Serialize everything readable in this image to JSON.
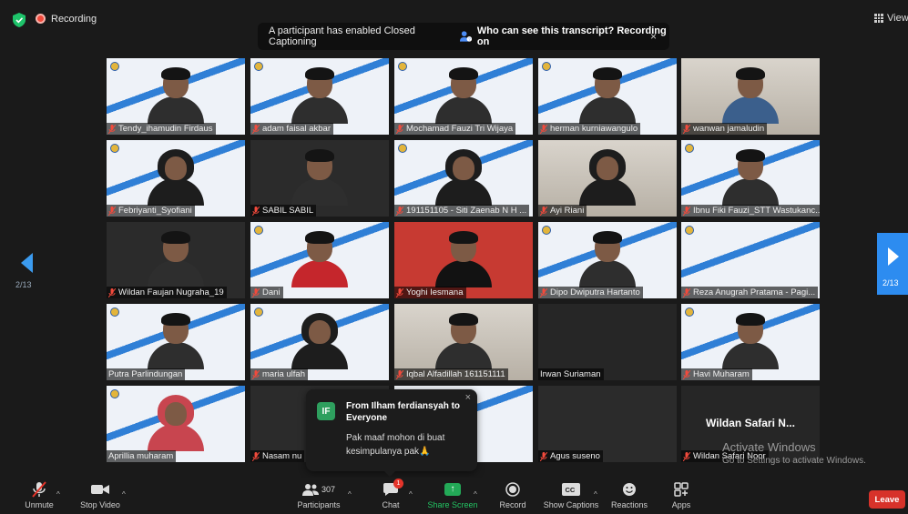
{
  "topbar": {
    "recording_label": "Recording",
    "view_label": "View",
    "caption_banner": {
      "notice": "A participant has enabled Closed Captioning",
      "question": "Who can see this transcript? Recording on",
      "close": "×"
    }
  },
  "gallery": {
    "page_left": "2/13",
    "page_right": "2/13",
    "tiles": [
      {
        "name": "Tendy_ihamudin Firdaus"
      },
      {
        "name": "adam faisal akbar"
      },
      {
        "name": "Mochamad Fauzi Tri Wijaya"
      },
      {
        "name": "herman kurniawangulo"
      },
      {
        "name": "wanwan jamaludin"
      },
      {
        "name": "Febriyanti_Syofiani"
      },
      {
        "name": "SABIL SABIL"
      },
      {
        "name": "191151105 - Siti Zaenab N H ..."
      },
      {
        "name": "Ayi Riani"
      },
      {
        "name": "Ibnu Fiki Fauzi_STT Wastukanc..."
      },
      {
        "name": "Wildan Faujan Nugraha_19"
      },
      {
        "name": "Dani"
      },
      {
        "name": "Yoghi Iesmana"
      },
      {
        "name": "Dipo Dwiputra Hartanto"
      },
      {
        "name": "Reza Anugrah Pratama - Pagi..."
      },
      {
        "name": "Putra Parlindungan"
      },
      {
        "name": "maria ulfah"
      },
      {
        "name": "Iqbal Alfadillah 161151111"
      },
      {
        "name": "Irwan Suriaman"
      },
      {
        "name": "Havi Muharam"
      },
      {
        "name": "Aprillia muharam"
      },
      {
        "name": "Nasam nu"
      },
      {
        "name": ""
      },
      {
        "name": "Agus suseno"
      },
      {
        "name": "Wildan Safari Noor",
        "center_label": "Wildan Safari N..."
      }
    ]
  },
  "chat_popup": {
    "avatar_initials": "IF",
    "from": "From Ilham ferdiansyah to Everyone",
    "message": "Pak maaf mohon di buat kesimpulanya pak🙏",
    "close": "×"
  },
  "watermark": {
    "title": "Activate Windows",
    "subtitle": "Go to Settings to activate Windows."
  },
  "toolbar": {
    "unmute": "Unmute",
    "stop_video": "Stop Video",
    "participants": "Participants",
    "participants_count": "307",
    "chat": "Chat",
    "chat_badge": "1",
    "share_screen": "Share Screen",
    "record": "Record",
    "show_captions": "Show Captions",
    "reactions": "Reactions",
    "apps": "Apps",
    "leave": "Leave"
  },
  "colors": {
    "accent_blue": "#2d8cf0",
    "share_green": "#23a957",
    "leave_red": "#d7322a",
    "record_red": "#f24a3c"
  }
}
